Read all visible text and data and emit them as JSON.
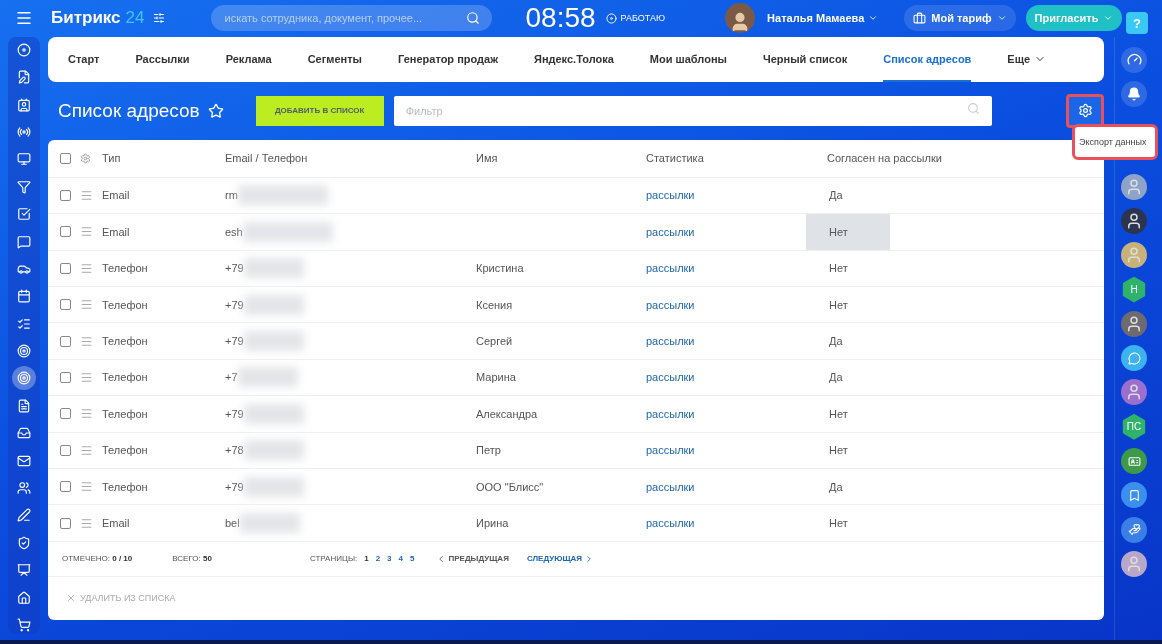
{
  "header": {
    "logo": "Битрикс",
    "logo_number": "24",
    "search": {
      "placeholder": "искать сотрудника, документ, прочее..."
    },
    "time": "08:58",
    "status": "РАБОТАЮ",
    "user": "Наталья Мамаева",
    "tariff": "Мой тариф",
    "invite": "Пригласить",
    "help": "?"
  },
  "left_sidebar": [
    {
      "selected": false
    },
    {
      "selected": false
    },
    {
      "selected": false
    },
    {
      "selected": false
    },
    {
      "selected": false
    },
    {
      "selected": false
    },
    {
      "selected": false
    },
    {
      "selected": false
    },
    {
      "selected": false
    },
    {
      "selected": false
    },
    {
      "selected": false
    },
    {
      "selected": false
    },
    {
      "selected": true
    },
    {
      "selected": false
    },
    {
      "selected": false
    },
    {
      "selected": false
    },
    {
      "selected": false
    },
    {
      "selected": false
    },
    {
      "selected": false
    },
    {
      "selected": false
    },
    {
      "selected": false
    },
    {
      "selected": false
    }
  ],
  "tabs": [
    {
      "label": "Старт",
      "selected": false
    },
    {
      "label": "Рассылки",
      "selected": false
    },
    {
      "label": "Реклама",
      "selected": false
    },
    {
      "label": "Сегменты",
      "selected": false
    },
    {
      "label": "Генератор продаж",
      "selected": false
    },
    {
      "label": "Яндекс.Толока",
      "selected": false
    },
    {
      "label": "Мои шаблоны",
      "selected": false
    },
    {
      "label": "Черный список",
      "selected": false
    },
    {
      "label": "Список адресов",
      "selected": true
    },
    {
      "label": "Еще",
      "selected": false
    }
  ],
  "page": {
    "title": "Список адресов",
    "add_button": "ДОБАВИТЬ В СПИСОК",
    "filter": {
      "placeholder": "Фильтр"
    },
    "settings_menu": "Экспорт данных"
  },
  "table": {
    "all_checked": false,
    "columns": [
      "Тип",
      "Email / Телефон",
      "Имя",
      "Статистика",
      "Согласен на рассылки"
    ],
    "rows": [
      {
        "type": "Email",
        "contact": "rm",
        "name": "",
        "stats": "рассылки",
        "agreed": "Да",
        "checked": false,
        "hovered": false
      },
      {
        "type": "Email",
        "contact": "esh",
        "name": "",
        "stats": "рассылки",
        "agreed": "Нет",
        "checked": false,
        "hovered": true
      },
      {
        "type": "Телефон",
        "contact": "+79",
        "name": "Кристина",
        "stats": "рассылки",
        "agreed": "Нет",
        "checked": false,
        "hovered": false
      },
      {
        "type": "Телефон",
        "contact": "+79",
        "name": "Ксения",
        "stats": "рассылки",
        "agreed": "Нет",
        "checked": false,
        "hovered": false
      },
      {
        "type": "Телефон",
        "contact": "+79",
        "name": "Сергей",
        "stats": "рассылки",
        "agreed": "Да",
        "checked": false,
        "hovered": false
      },
      {
        "type": "Телефон",
        "contact": "+7",
        "name": "Марина",
        "stats": "рассылки",
        "agreed": "Да",
        "checked": false,
        "hovered": false
      },
      {
        "type": "Телефон",
        "contact": "+79",
        "name": "Александра",
        "stats": "рассылки",
        "agreed": "Нет",
        "checked": false,
        "hovered": false
      },
      {
        "type": "Телефон",
        "contact": "+78",
        "name": "Петр",
        "stats": "рассылки",
        "agreed": "Нет",
        "checked": false,
        "hovered": false
      },
      {
        "type": "Телефон",
        "contact": "+79",
        "name": "ООО \"Блисс\"",
        "stats": "рассылки",
        "agreed": "Да",
        "checked": false,
        "hovered": false
      },
      {
        "type": "Email",
        "contact": "bel",
        "name": "Ирина",
        "stats": "рассылки",
        "agreed": "Нет",
        "checked": false,
        "hovered": false
      }
    ]
  },
  "footer": {
    "marked_label": "ОТМЕЧЕНО:",
    "marked": "0 / 10",
    "total_label": "ВСЕГО:",
    "total": "50",
    "pages_label": "СТРАНИЦЫ:",
    "pages": [
      {
        "label": "1",
        "selected": true
      },
      {
        "label": "2",
        "selected": false
      },
      {
        "label": "3",
        "selected": false
      },
      {
        "label": "4",
        "selected": false
      },
      {
        "label": "5",
        "selected": false
      }
    ],
    "prev": "ПРЕДЫДУЩАЯ",
    "next": "СЛЕДУЮЩАЯ",
    "delete": "УДАЛИТЬ ИЗ СПИСКА"
  },
  "right_bar": [
    {
      "kind": "avatar",
      "color": "#8ea3c8"
    },
    {
      "kind": "avatar",
      "color": "#2b3550"
    },
    {
      "kind": "avatar",
      "color": "#c9b27a"
    },
    {
      "kind": "hex",
      "label": "Н",
      "color": "#2fb36b"
    },
    {
      "kind": "avatar",
      "color": "#6d6a70"
    },
    {
      "kind": "icon",
      "color": "#3bb3f0"
    },
    {
      "kind": "avatar",
      "color": "#9a6fd0"
    },
    {
      "kind": "hex",
      "label": "ПС",
      "color": "#2fb36b"
    },
    {
      "kind": "icon",
      "color": "#3c9a48"
    },
    {
      "kind": "icon",
      "color": "#3a8ff0"
    },
    {
      "kind": "icon",
      "color": "#3a7fe8"
    },
    {
      "kind": "avatar",
      "color": "#b8a7c8"
    }
  ]
}
